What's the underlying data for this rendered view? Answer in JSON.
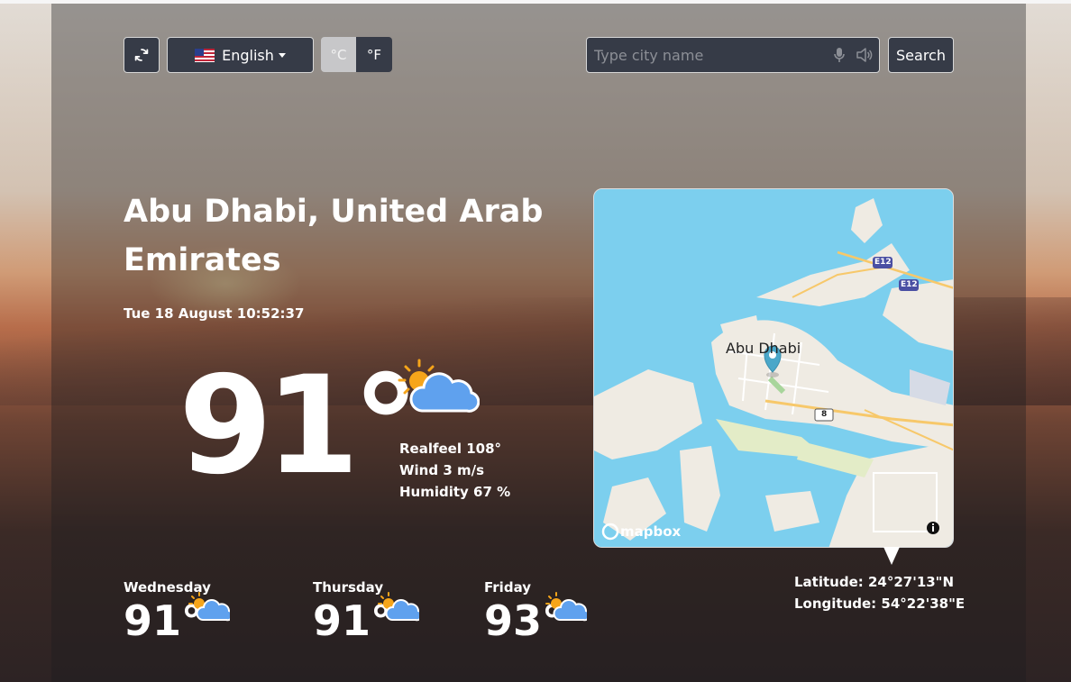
{
  "header": {
    "refresh_icon": "refresh-icon",
    "language_label": "English",
    "unit_celsius": "°C",
    "unit_fahrenheit": "°F",
    "search_placeholder": "Type city name",
    "search_button": "Search",
    "mic_icon": "microphone-icon",
    "speaker_icon": "speaker-icon"
  },
  "current": {
    "city": "Abu Dhabi, United Arab Emirates",
    "datetime": "Tue 18 August 10:52:37",
    "temperature": "91°",
    "icon": "sun-cloud-icon",
    "realfeel": "Realfeel 108°",
    "wind": "Wind 3 m/s",
    "humidity": "Humidity 67 %"
  },
  "map": {
    "place_label": "Abu Dhabi",
    "road_label_1": "E12",
    "road_label_2": "E12",
    "road_label_3": "8",
    "brand": "mapbox",
    "latitude": "Latitude: 24°27'13\"N",
    "longitude": "Longitude: 54°22'38\"E"
  },
  "forecast": [
    {
      "day": "Wednesday",
      "temp": "91°",
      "icon": "sun-cloud-icon"
    },
    {
      "day": "Thursday",
      "temp": "91°",
      "icon": "sun-cloud-icon"
    },
    {
      "day": "Friday",
      "temp": "93°",
      "icon": "sun-cloud-icon"
    }
  ],
  "colors": {
    "button_bg": "#363b47",
    "sea": "#7ccfee",
    "land": "#efebe3",
    "marker": "#4aa7c9",
    "cloud": "#5fa1ee",
    "sun": "#f6a51a"
  }
}
